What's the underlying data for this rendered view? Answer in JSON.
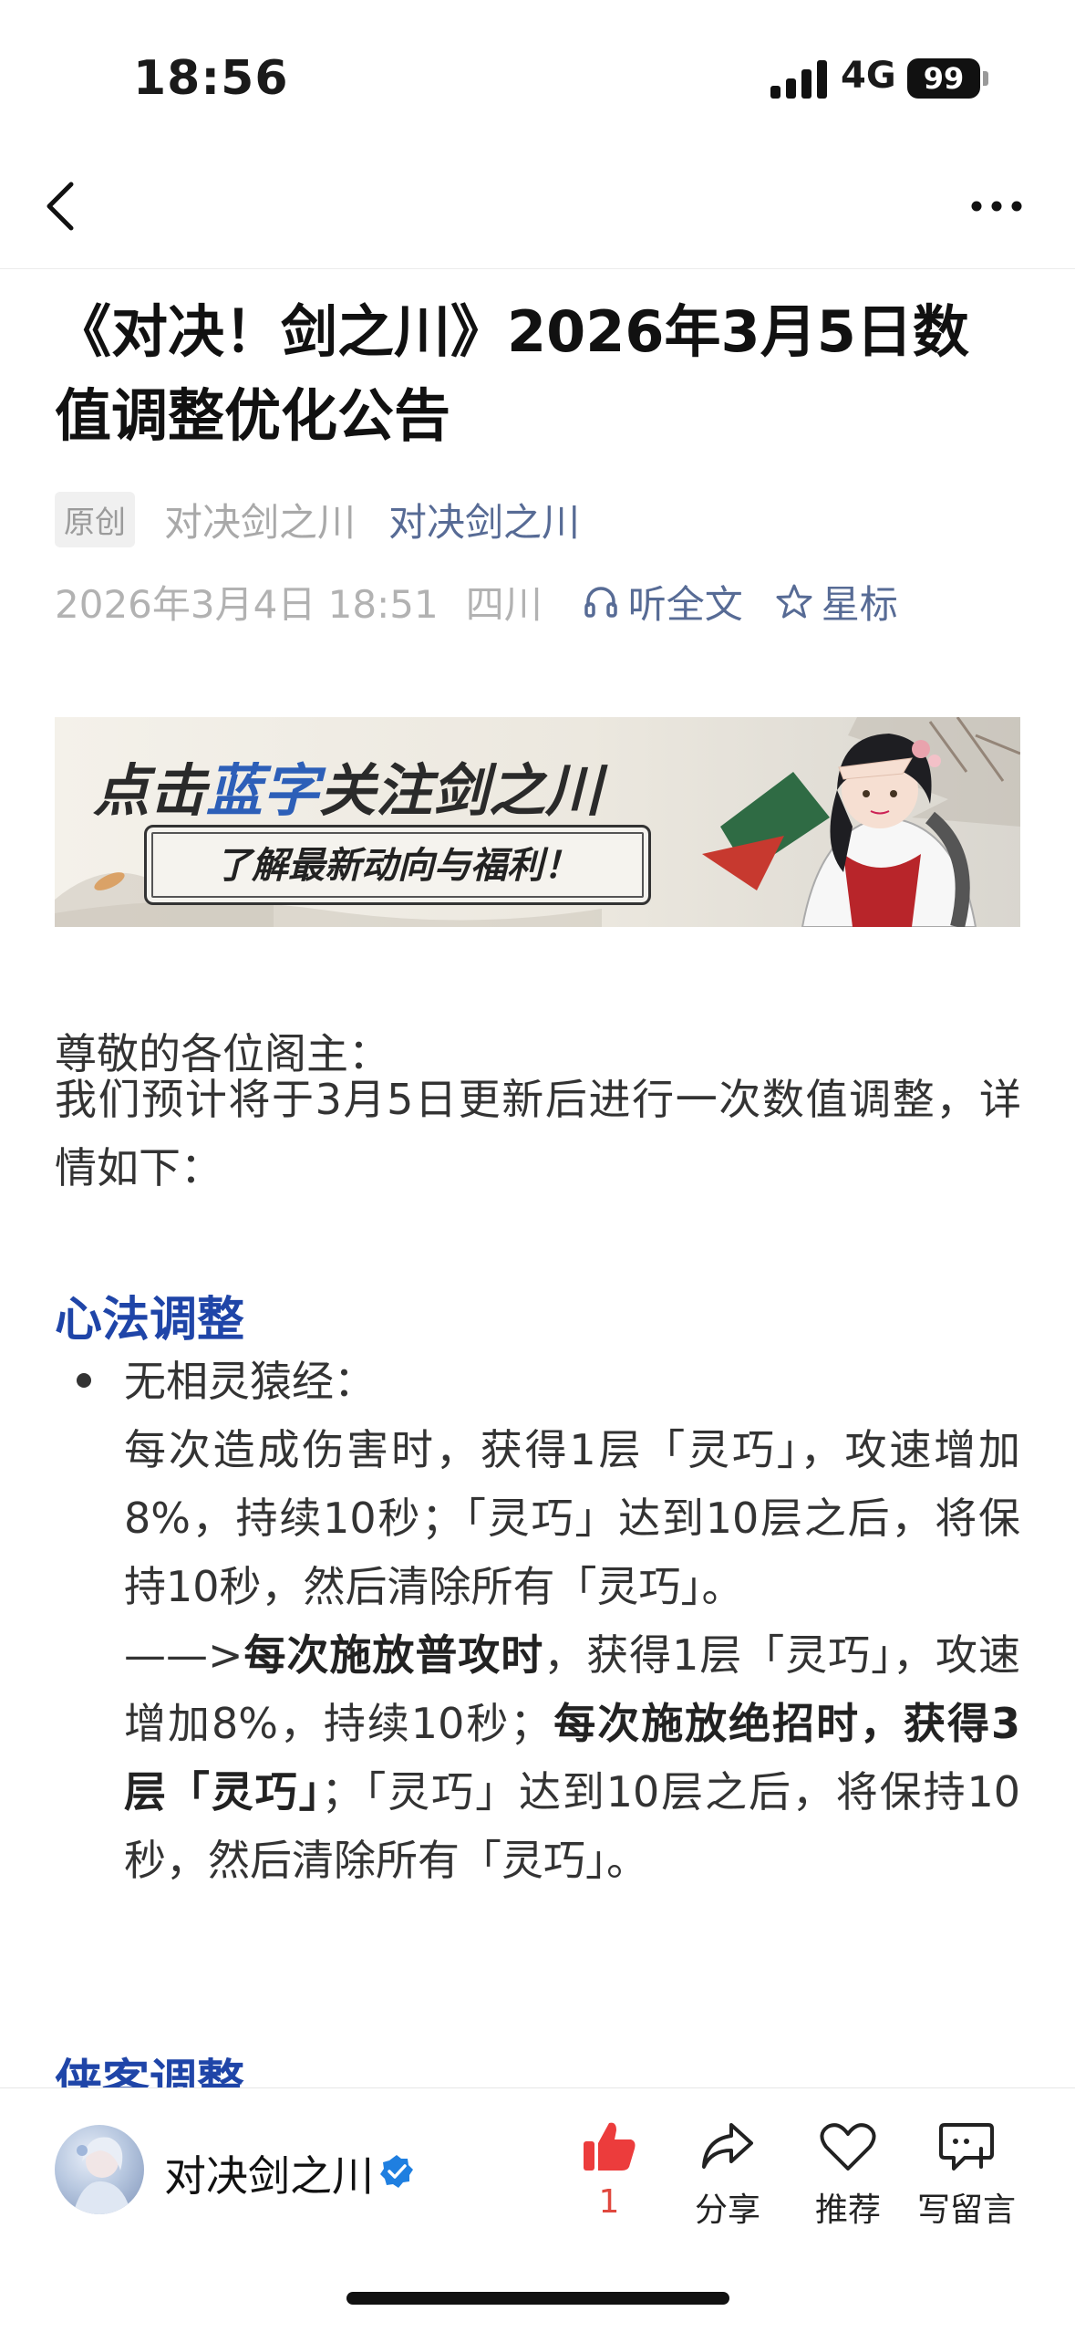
{
  "status_bar": {
    "time": "18:56",
    "network": "4G",
    "battery": "99"
  },
  "nav": {},
  "article": {
    "title": "《对决！剑之川》2026年3月5日数值调整优化公告",
    "tag": "原创",
    "author_gray": "对决剑之川",
    "author_blue": "对决剑之川",
    "date": "2026年3月4日 18:51",
    "location": "四川",
    "listen": "听全文",
    "star": "星标"
  },
  "banner": {
    "head_part1": "点击",
    "head_blue": "蓝字",
    "head_part2": "关注剑之川",
    "pill": "了解最新动向与福利！"
  },
  "content": {
    "greeting": "尊敬的各位阁主：",
    "intro": "我们预计将于3月5日更新后进行一次数值调整，详情如下：",
    "section1": "心法调整",
    "item_name": "无相灵猿经：",
    "item_old": "每次造成伤害时，获得1层「灵巧」，攻速增加8%，持续10秒；「灵巧」达到10层之后，将保持10秒，然后清除所有「灵巧」。",
    "arrow": "——>",
    "new_b1": "每次施放普攻时",
    "new_t1": "，获得1层「灵巧」，攻速增加8%，持续10秒；",
    "new_b2": "每次施放绝招时，获得3层「灵巧」",
    "new_t2": "；「灵巧」达到10层之后，将保持10秒，然后清除所有「灵巧」。",
    "section2": "侠客调整"
  },
  "bottom_bar": {
    "account": "对决剑之川",
    "like_count": "1",
    "share": "分享",
    "recommend": "推荐",
    "comment": "写留言"
  }
}
